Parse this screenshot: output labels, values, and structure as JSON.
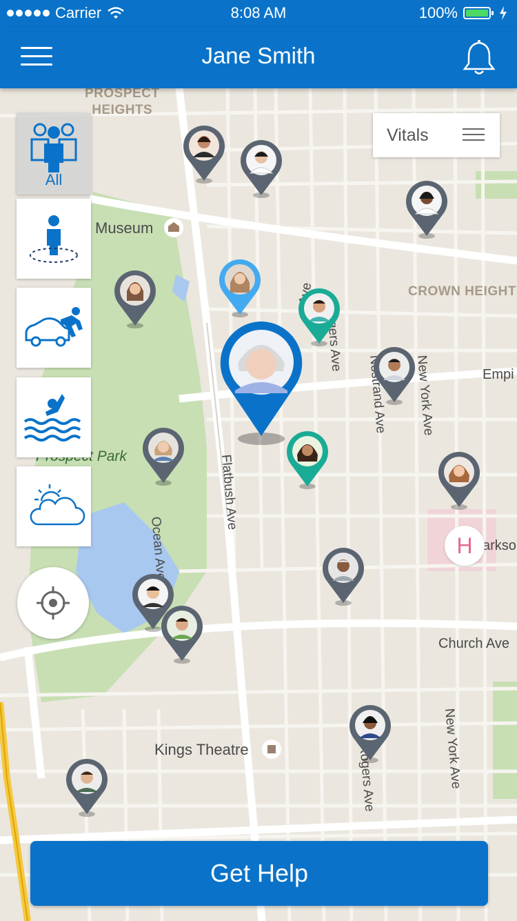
{
  "status_bar": {
    "carrier": "Carrier",
    "time": "8:08 AM",
    "battery": "100%",
    "icons": [
      "signal-dots-icon",
      "wifi-icon",
      "battery-icon",
      "charging-bolt-icon"
    ]
  },
  "header": {
    "title": "Jane Smith",
    "icons": [
      "hamburger-menu-icon",
      "bell-icon"
    ]
  },
  "filters": {
    "all_label": "All",
    "items": [
      "all-people-icon",
      "person-location-icon",
      "car-accident-icon",
      "drowning-icon",
      "weather-icon"
    ]
  },
  "vitals": {
    "label": "Vitals"
  },
  "map_labels": {
    "prospect_heights": "PROSPECT\nHEIGHTS",
    "crown_heights": "CROWN HEIGHTS",
    "museum": "Museum",
    "prospect_park": "Prospect Park",
    "ocean_ave": "Ocean Ave",
    "flatbush_ave": "Flatbush Ave",
    "rogers_ave": "Rogers Ave",
    "rogers_ave_2": "Rogers Ave",
    "nostrand_ave": "Nostrand Ave",
    "new_york_ave": "New York Ave",
    "new_york_ave_2": "New York Ave",
    "church_ave": "Church Ave",
    "empire": "Empi",
    "parkside": "arkso",
    "kings_theatre": "Kings Theatre",
    "ave": "Ave",
    "hospital": "H"
  },
  "colors": {
    "primary": "#0a73c9",
    "pin_gray": "#5b6572",
    "pin_teal": "#1aab96",
    "pin_light_blue": "#42aaf0",
    "park_green": "#c8dfb4",
    "water_blue": "#a8c8f0",
    "hospital_pink": "#e6688c"
  },
  "action": {
    "get_help": "Get Help"
  }
}
